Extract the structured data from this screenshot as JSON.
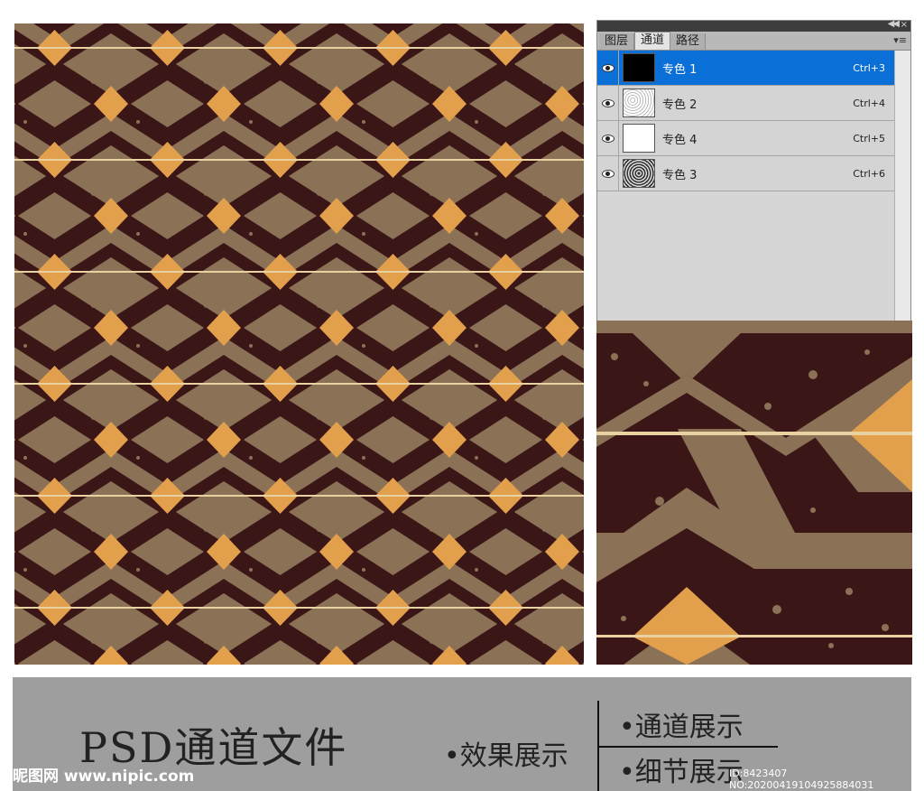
{
  "panel": {
    "tabs": [
      "图层",
      "通道",
      "路径"
    ],
    "active_tab": "通道",
    "channels": [
      {
        "label": "专色 1",
        "shortcut": "Ctrl+3",
        "selected": true,
        "thumb": "black"
      },
      {
        "label": "专色 2",
        "shortcut": "Ctrl+4",
        "selected": false,
        "thumb": "speckle-light"
      },
      {
        "label": "专色 4",
        "shortcut": "Ctrl+5",
        "selected": false,
        "thumb": "white"
      },
      {
        "label": "专色 3",
        "shortcut": "Ctrl+6",
        "selected": false,
        "thumb": "speckle-dark"
      }
    ]
  },
  "banner": {
    "title": "PSD通道文件",
    "effect": "•效果展示",
    "channel_show": "•通道展示",
    "detail_show": "•细节展示"
  },
  "watermark": {
    "site": "昵图网 www.nipic.com",
    "id": "ID:8423407 NO:20200419104925884031"
  },
  "colors": {
    "brown_dark": "#3b1617",
    "tan": "#8b7256",
    "orange": "#e3a04c",
    "cream": "#e9d2a2",
    "selection": "#0a6fd6"
  }
}
